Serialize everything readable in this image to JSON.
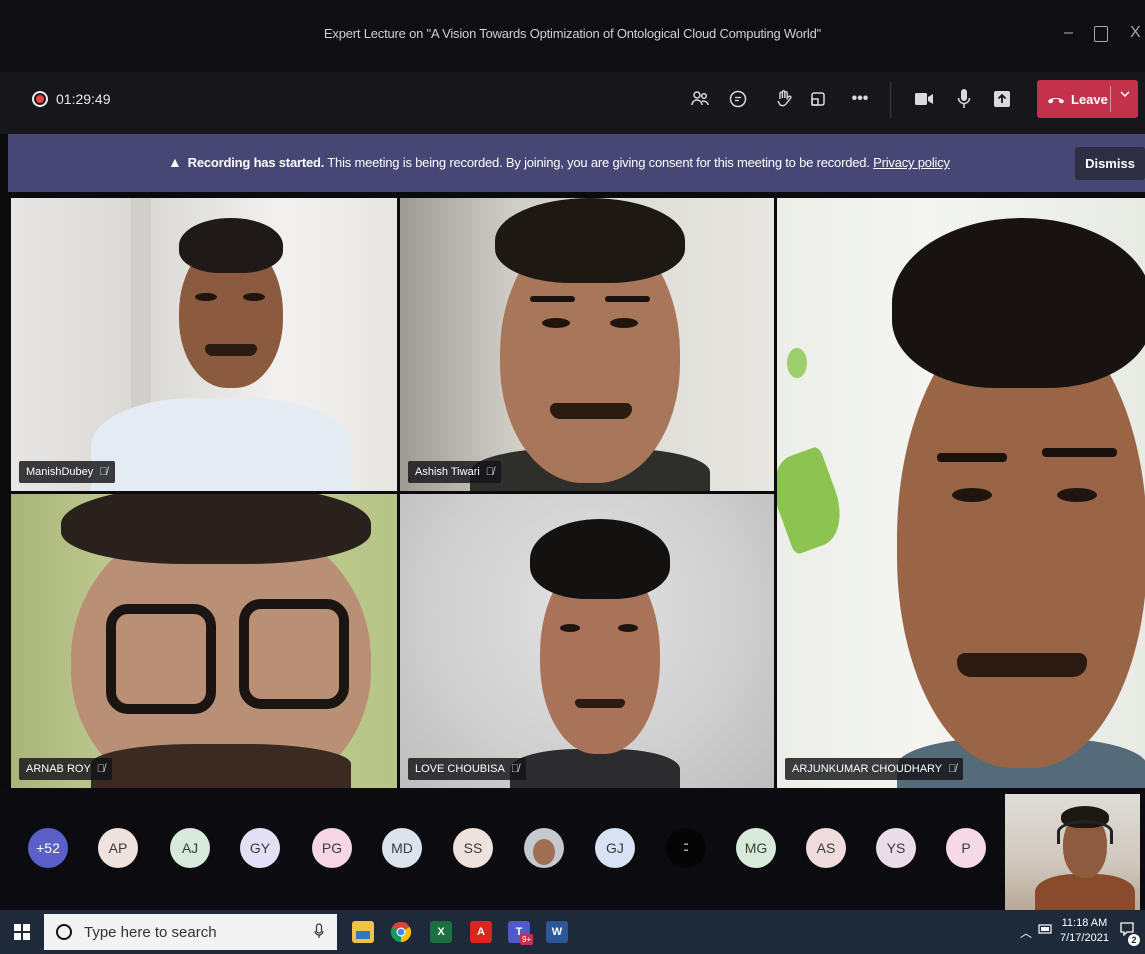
{
  "window": {
    "title": "Expert Lecture on \"A Vision Towards Optimization of Ontological Cloud Computing World\"",
    "minimize_glyph": "–",
    "close_glyph": "X"
  },
  "toolbar": {
    "timer": "01:29:49",
    "leave_label": "Leave",
    "icons": [
      "participants-icon",
      "chat-icon",
      "raise-hand-icon",
      "breakout-icon",
      "more-icon",
      "camera-icon",
      "mic-icon",
      "share-icon"
    ]
  },
  "banner": {
    "bold_text": "Recording has started.",
    "text": " This meeting is being recorded. By joining, you are giving consent for this meeting to be recorded. ",
    "link_text": "Privacy policy",
    "dismiss_label": "Dismiss",
    "bg_color": "#464775"
  },
  "participants": {
    "tiles": [
      {
        "name": "ManishDubey"
      },
      {
        "name": "Ashish Tiwari"
      },
      {
        "name": "ARJUNKUMAR CHOUDHARY"
      },
      {
        "name": "ARNAB ROY"
      },
      {
        "name": "LOVE CHOUBISA"
      }
    ],
    "avatars": [
      {
        "initials": "+52",
        "color": "#5b5fc7",
        "text_color": "#ffffff"
      },
      {
        "initials": "AP",
        "color": "#f0e2dc"
      },
      {
        "initials": "AJ",
        "color": "#d8ead9"
      },
      {
        "initials": "GY",
        "color": "#e2e0f5"
      },
      {
        "initials": "PG",
        "color": "#f6d6e6"
      },
      {
        "initials": "MD",
        "color": "#dbe4ee"
      },
      {
        "initials": "SS",
        "color": "#efe2dd"
      },
      {
        "initials": "",
        "color": "#c4c8cf",
        "photo": true
      },
      {
        "initials": "GJ",
        "color": "#d7e3f5"
      },
      {
        "initials": "",
        "color": "#050505",
        "photo": true
      },
      {
        "initials": "MG",
        "color": "#d8ead9"
      },
      {
        "initials": "AS",
        "color": "#f0dcdc"
      },
      {
        "initials": "YS",
        "color": "#ecdceb"
      },
      {
        "initials": "P",
        "color": "#f6d9e6"
      }
    ]
  },
  "taskbar": {
    "search_placeholder": "Type here to search",
    "time": "11:18 AM",
    "date": "7/17/2021",
    "notification_count": "2",
    "teams_badge": "9+"
  },
  "colors": {
    "leave_red": "#c4314b",
    "teams_toolbar": "#16161b",
    "taskbar": "#1e2a3a"
  }
}
